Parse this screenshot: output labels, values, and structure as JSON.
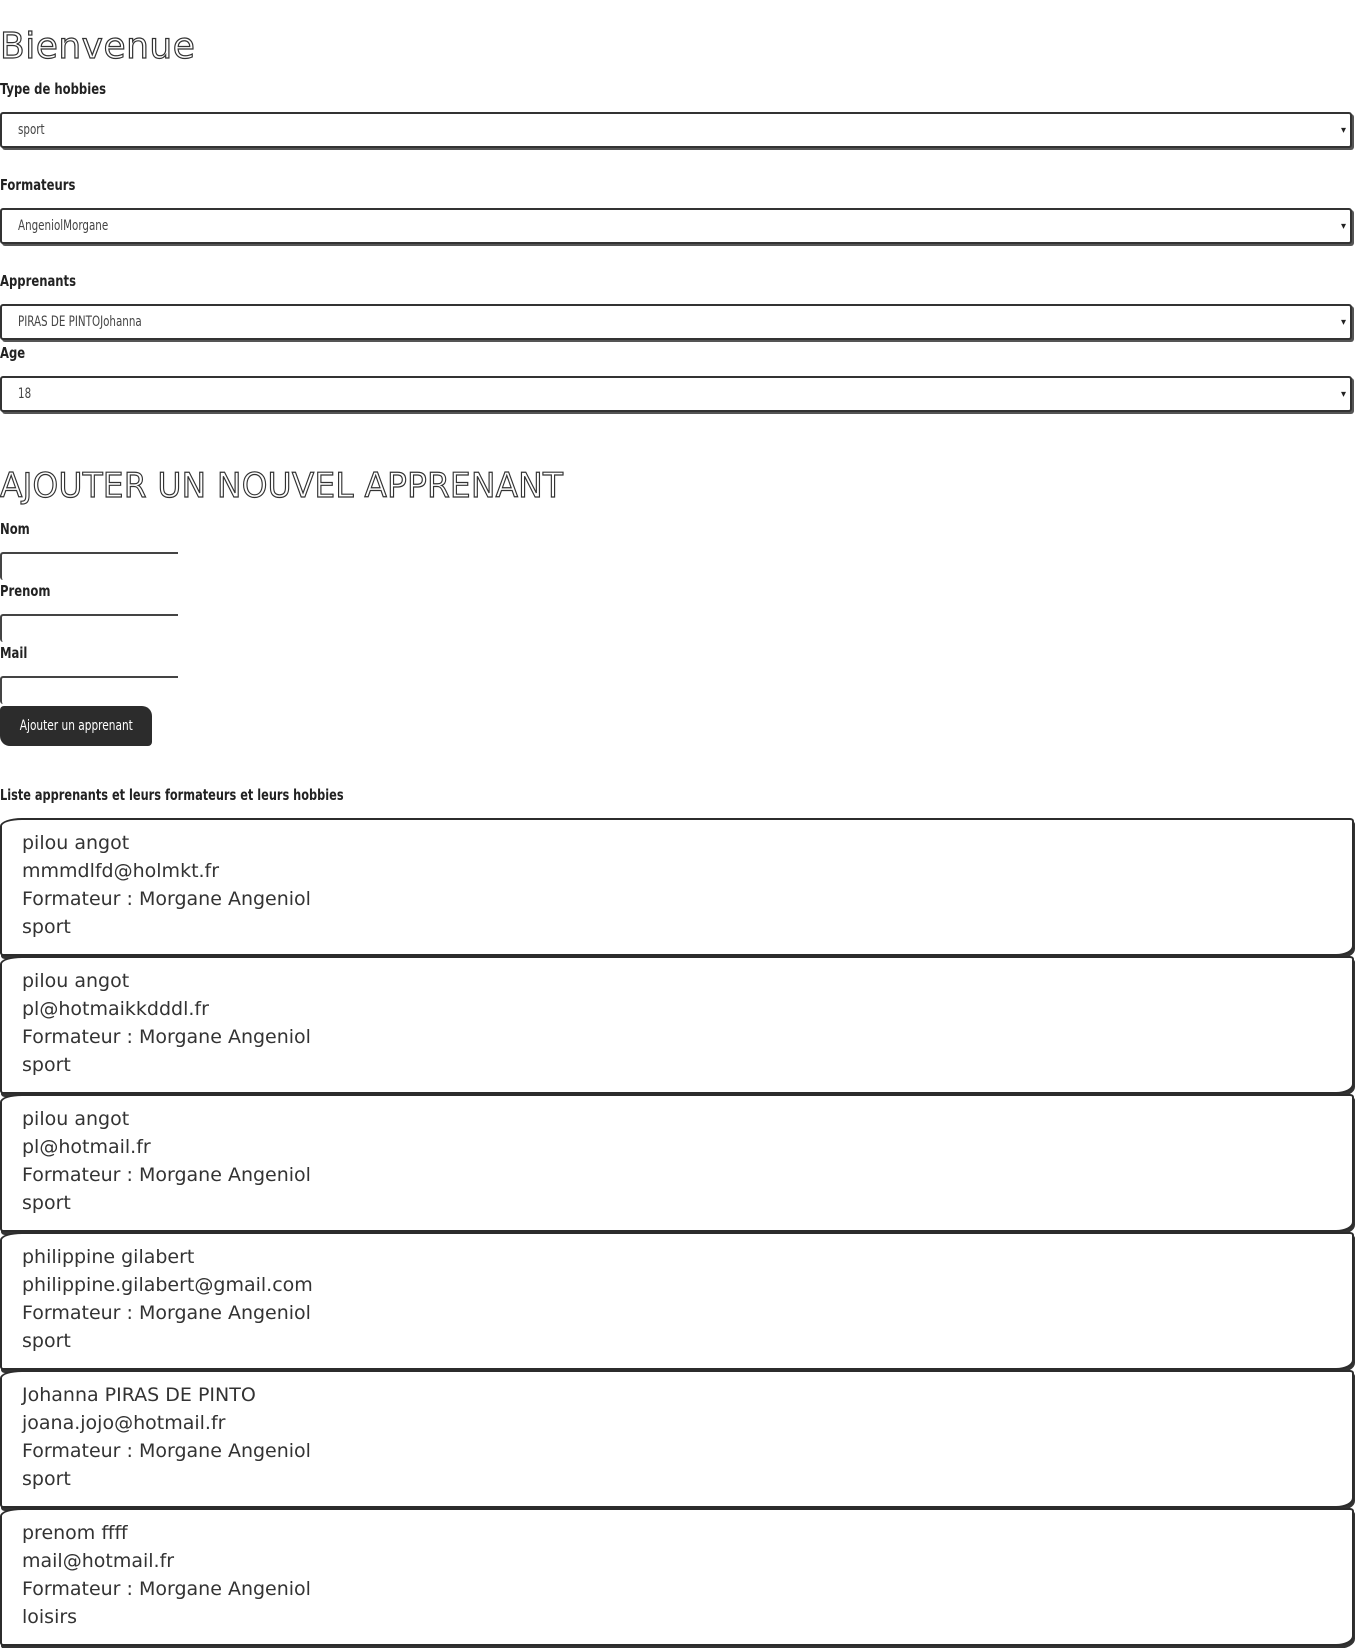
{
  "header": {
    "title": "Bienvenue"
  },
  "filters": {
    "hobbies": {
      "label": "Type de hobbies",
      "value": "sport"
    },
    "formateurs": {
      "label": "Formateurs",
      "value": "AngeniolMorgane"
    },
    "apprenants": {
      "label": "Apprenants",
      "value": "PIRAS DE PINTOJohanna"
    },
    "age": {
      "label": "Age",
      "value": "18"
    }
  },
  "add_form": {
    "title": "AJOUTER UN NOUVEL APPRENANT",
    "nom_label": "Nom",
    "prenom_label": "Prenom",
    "mail_label": "Mail",
    "nom_value": "",
    "prenom_value": "",
    "mail_value": "",
    "submit_label": "Ajouter un apprenant"
  },
  "list": {
    "heading": "Liste apprenants et leurs formateurs et leurs hobbies",
    "items": [
      {
        "name": "pilou angot",
        "email": "mmmdlfd@holmkt.fr",
        "formateur": "Formateur : Morgane Angeniol",
        "hobby": "sport"
      },
      {
        "name": "pilou angot",
        "email": "pl@hotmaikkdddl.fr",
        "formateur": "Formateur : Morgane Angeniol",
        "hobby": "sport"
      },
      {
        "name": "pilou angot",
        "email": "pl@hotmail.fr",
        "formateur": "Formateur : Morgane Angeniol",
        "hobby": "sport"
      },
      {
        "name": "philippine gilabert",
        "email": "philippine.gilabert@gmail.com",
        "formateur": "Formateur : Morgane Angeniol",
        "hobby": "sport"
      },
      {
        "name": "Johanna PIRAS DE PINTO",
        "email": "joana.jojo@hotmail.fr",
        "formateur": "Formateur : Morgane Angeniol",
        "hobby": "sport"
      },
      {
        "name": "prenom ffff",
        "email": "mail@hotmail.fr",
        "formateur": "Formateur : Morgane Angeniol",
        "hobby": "loisirs"
      }
    ]
  }
}
